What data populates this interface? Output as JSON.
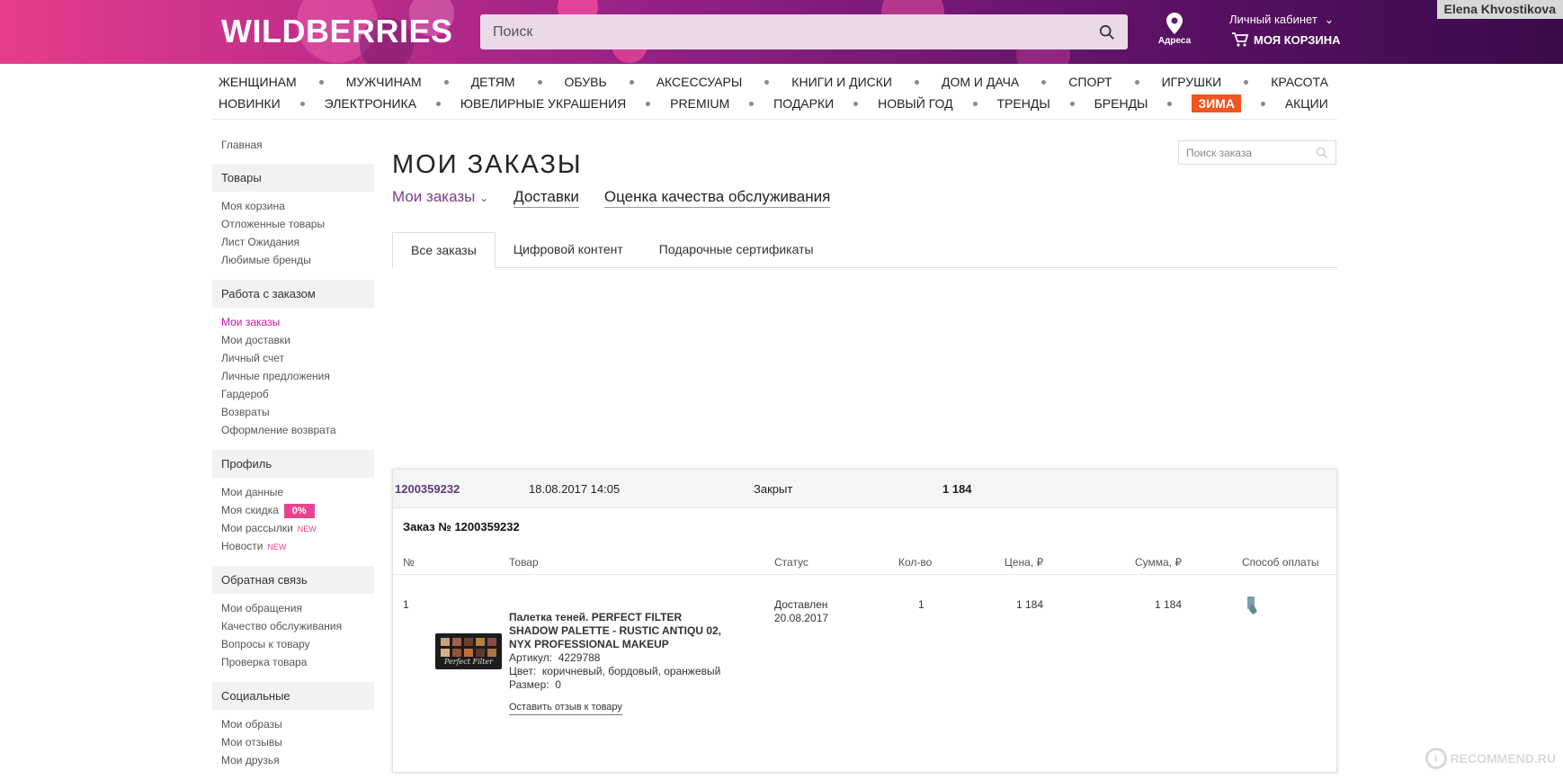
{
  "header": {
    "logo": "WILDBERRIES",
    "search_placeholder": "Поиск",
    "address_label": "Адреса",
    "cabinet_label": "Личный кабинет",
    "cart_label": "МОЯ КОРЗИНА",
    "user_name": "Elena Khvostikova",
    "brand_colors": [
      "#e63c8e",
      "#8f1f84",
      "#3b0a4a"
    ]
  },
  "nav": {
    "row1": [
      "ЖЕНЩИНАМ",
      "МУЖЧИНАМ",
      "ДЕТЯМ",
      "ОБУВЬ",
      "АКСЕССУАРЫ",
      "КНИГИ И ДИСКИ",
      "ДОМ И ДАЧА",
      "СПОРТ",
      "ИГРУШКИ",
      "КРАСОТА"
    ],
    "row2": [
      "НОВИНКИ",
      "ЭЛЕКТРОНИКА",
      "ЮВЕЛИРНЫЕ УКРАШЕНИЯ",
      "PREMIUM",
      "ПОДАРКИ",
      "НОВЫЙ ГОД",
      "ТРЕНДЫ",
      "БРЕНДЫ",
      "ЗИМА",
      "АКЦИИ"
    ],
    "highlight": "ЗИМА",
    "highlight_color": "#f2551d"
  },
  "sidebar": {
    "home": "Главная",
    "groups": [
      {
        "title": "Товары",
        "items": [
          "Моя корзина",
          "Отложенные товары",
          "Лист Ожидания",
          "Любимые бренды"
        ]
      },
      {
        "title": "Работа с заказом",
        "items": [
          "Мои заказы",
          "Мои доставки",
          "Личный счет",
          "Личные предложения",
          "Гардероб",
          "Возвраты",
          "Оформление возврата"
        ],
        "active": "Мои заказы"
      },
      {
        "title": "Профиль",
        "items": [
          "Мои данные",
          "Моя скидка",
          "Мои рассылки",
          "Новости"
        ],
        "discount_badge": "0%",
        "new_label": "NEW"
      },
      {
        "title": "Обратная связь",
        "items": [
          "Мои обращения",
          "Качество обслуживания",
          "Вопросы к товару",
          "Проверка товара"
        ]
      },
      {
        "title": "Социальные",
        "items": [
          "Мои образы",
          "Мои отзывы",
          "Мои друзья"
        ]
      }
    ]
  },
  "main": {
    "title": "МОИ ЗАКАЗЫ",
    "subnav": [
      "Мои заказы",
      "Доставки",
      "Оценка качества обслуживания"
    ],
    "order_search_placeholder": "Поиск заказа",
    "tabs": [
      "Все заказы",
      "Цифровой контент",
      "Подарочные сертификаты"
    ],
    "order": {
      "number": "1200359232",
      "date": "18.08.2017 14:05",
      "status": "Закрыт",
      "total": "1 184",
      "detail_title": "Заказ № 1200359232",
      "columns": [
        "№",
        "Товар",
        "Статус",
        "Кол-во",
        "Цена, ₽",
        "Сумма, ₽",
        "Способ оплаты"
      ],
      "item": {
        "idx": "1",
        "name": "Палетка теней. PERFECT FILTER SHADOW PALETTE - RUSTIC ANTIQU 02, NYX PROFESSIONAL MAKEUP",
        "article_label": "Артикул:",
        "article": "4229788",
        "color_label": "Цвет:",
        "color": "коричневый, бордовый, оранжевый",
        "size_label": "Размер:",
        "size": "0",
        "feedback": "Оставить отзыв к товару",
        "status": "Доставлен",
        "status_date": "20.08.2017",
        "qty": "1",
        "price": "1 184",
        "sum": "1 184",
        "palette_script": "Perfect Filter"
      }
    }
  },
  "watermark": "RECOMMEND.RU"
}
